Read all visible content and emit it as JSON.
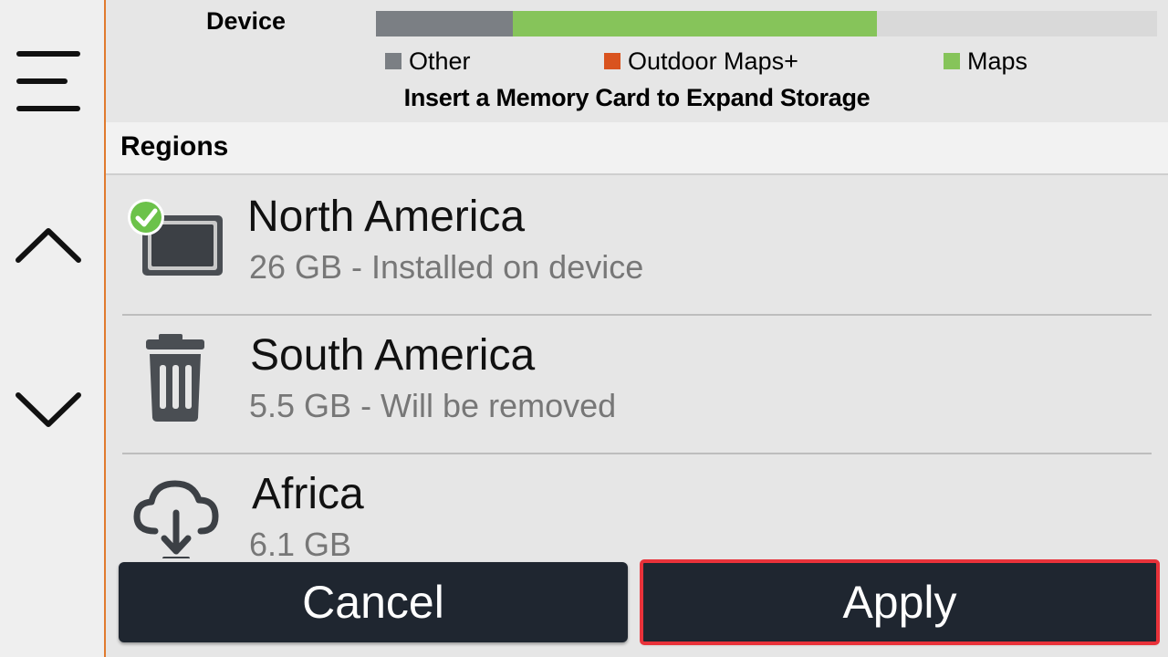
{
  "storage": {
    "device_label": "Device",
    "bar": [
      {
        "name": "Other",
        "fraction": 0.175,
        "color": "#7b7f84"
      },
      {
        "name": "Maps",
        "fraction": 0.466,
        "color": "#86c45a"
      }
    ],
    "legend": [
      {
        "label": "Other",
        "color": "#7b7f84"
      },
      {
        "label": "Outdoor Maps+",
        "color": "#d9531e"
      },
      {
        "label": "Maps",
        "color": "#86c45a"
      }
    ],
    "insert_message": "Insert a Memory Card to Expand Storage"
  },
  "regions": {
    "header": "Regions",
    "items": [
      {
        "name": "North America",
        "detail": "26 GB - Installed on device",
        "icon": "device-installed-icon"
      },
      {
        "name": "South America",
        "detail": "5.5 GB - Will be removed",
        "icon": "trash-icon"
      },
      {
        "name": "Africa",
        "detail": "6.1 GB",
        "icon": "cloud-download-icon"
      }
    ]
  },
  "nav": {
    "menu_icon": "hamburger-menu-icon",
    "up_icon": "chevron-up-icon",
    "down_icon": "chevron-down-icon"
  },
  "actions": {
    "cancel_label": "Cancel",
    "apply_label": "Apply"
  },
  "colors": {
    "accent": "#e07a2e",
    "button_bg": "#1f2630",
    "highlight": "#e8323a",
    "check_green": "#6cc24a"
  }
}
